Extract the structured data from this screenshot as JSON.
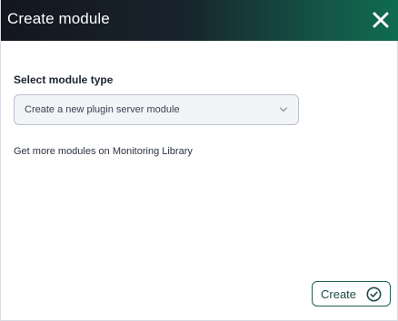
{
  "dialog": {
    "title": "Create module",
    "close_icon": "close-icon"
  },
  "form": {
    "module_type_label": "Select module type",
    "module_type_value": "Create a new plugin server module",
    "chevron_icon": "chevron-down-icon",
    "library_link": "Get more modules on Monitoring Library"
  },
  "footer": {
    "create_label": "Create",
    "create_icon": "check-circle-icon"
  },
  "colors": {
    "title_gradient_start": "#14161f",
    "title_gradient_end": "#0f6c4f",
    "accent": "#1d5e52"
  }
}
